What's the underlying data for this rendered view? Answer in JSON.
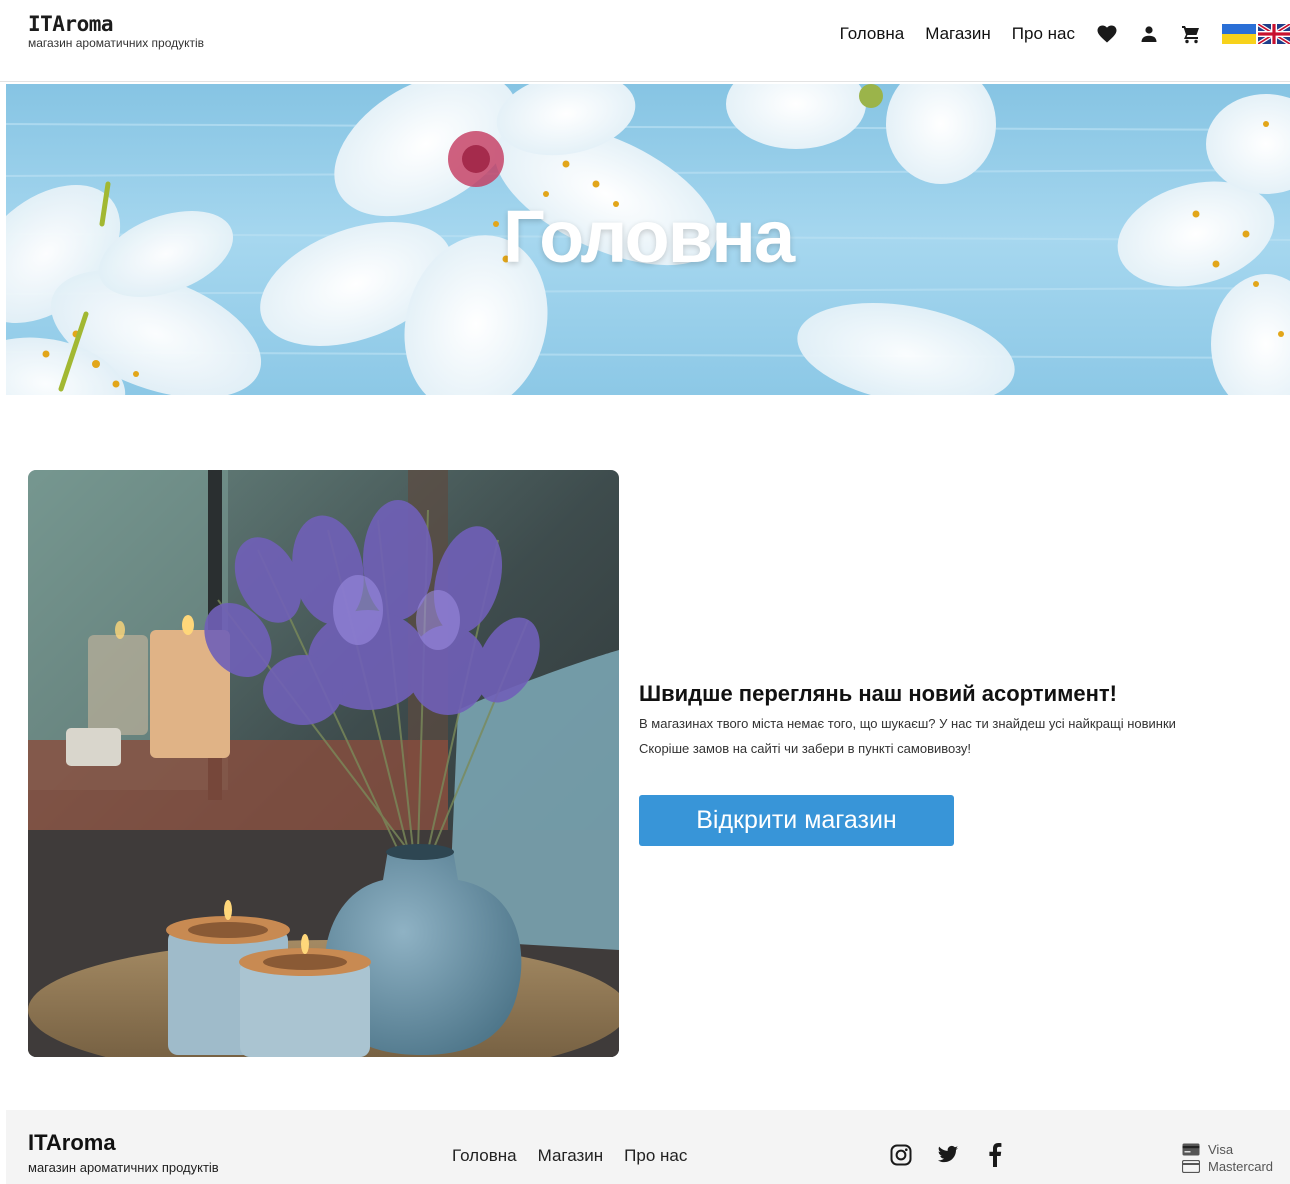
{
  "header": {
    "brand_title": "ITAroma",
    "brand_tagline": "магазин ароматичних продуктів",
    "nav": [
      {
        "label": "Головна"
      },
      {
        "label": "Магазин"
      },
      {
        "label": "Про нас"
      }
    ],
    "icons": [
      "heart-icon",
      "user-icon",
      "cart-icon",
      "flag-ua-icon",
      "flag-gb-icon"
    ]
  },
  "hero": {
    "title": "Головна"
  },
  "promo": {
    "heading": "Швидше переглянь наш новий асортимент!",
    "line1": "В магазинах твого міста немає того, що шукаєш? У нас ти знайдеш усі найкращі новинки",
    "line2": "Скоріше замов на сайті чи забери в пункті самовивозу!",
    "button_label": "Відкрити магазин"
  },
  "footer": {
    "brand_title": "ITAroma",
    "brand_tagline": "магазин ароматичних продуктів",
    "nav": [
      {
        "label": "Головна"
      },
      {
        "label": "Магазин"
      },
      {
        "label": "Про нас"
      }
    ],
    "social": [
      "instagram-icon",
      "twitter-icon",
      "facebook-icon"
    ],
    "payments": [
      {
        "label": "Visa"
      },
      {
        "label": "Mastercard"
      }
    ]
  },
  "colors": {
    "accent": "#3895d8",
    "footer_bg": "#f4f4f4",
    "hero_bg": "#9fd4ee"
  }
}
